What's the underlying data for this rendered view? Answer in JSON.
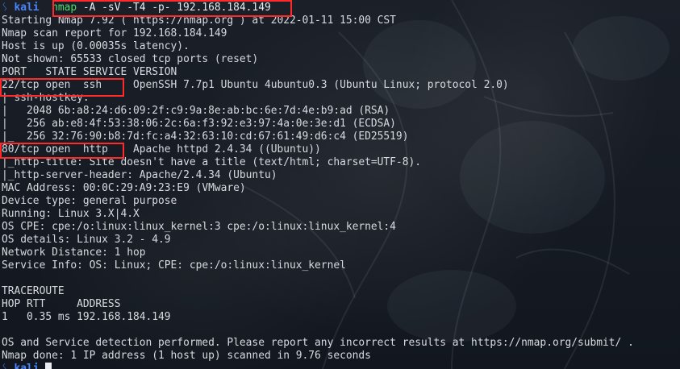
{
  "terminal": {
    "prompt": {
      "icon": "kali-dragon-icon",
      "user": "kali",
      "command_name": "nmap",
      "command_args": " -A -sV -T4 -p- 192.168.184.149"
    },
    "output": [
      "Starting Nmap 7.92 ( https://nmap.org ) at 2022-01-11 15:00 CST",
      "Nmap scan report for 192.168.184.149",
      "Host is up (0.00035s latency).",
      "Not shown: 65533 closed tcp ports (reset)",
      "PORT   STATE SERVICE VERSION",
      "22/tcp open  ssh     OpenSSH 7.7p1 Ubuntu 4ubuntu0.3 (Ubuntu Linux; protocol 2.0)",
      "| ssh-hostkey:",
      "|   2048 6b:a8:24:d6:09:2f:c9:9a:8e:ab:bc:6e:7d:4e:b9:ad (RSA)",
      "|   256 ab:e8:4f:53:38:06:2c:6a:f3:92:e3:97:4a:0e:3e:d1 (ECDSA)",
      "|_  256 32:76:90:b8:7d:fc:a4:32:63:10:cd:67:61:49:d6:c4 (ED25519)",
      "80/tcp open  http    Apache httpd 2.4.34 ((Ubuntu))",
      "|_http-title: Site doesn't have a title (text/html; charset=UTF-8).",
      "|_http-server-header: Apache/2.4.34 (Ubuntu)",
      "MAC Address: 00:0C:29:A9:23:E9 (VMware)",
      "Device type: general purpose",
      "Running: Linux 3.X|4.X",
      "OS CPE: cpe:/o:linux:linux_kernel:3 cpe:/o:linux:linux_kernel:4",
      "OS details: Linux 3.2 - 4.9",
      "Network Distance: 1 hop",
      "Service Info: OS: Linux; CPE: cpe:/o:linux:linux_kernel",
      "",
      "TRACEROUTE",
      "HOP RTT     ADDRESS",
      "1   0.35 ms 192.168.184.149",
      "",
      "OS and Service detection performed. Please report any incorrect results at https://nmap.org/submit/ .",
      "Nmap done: 1 IP address (1 host up) scanned in 9.76 seconds"
    ],
    "final_prompt": {
      "user": "kali"
    }
  },
  "colors": {
    "prompt": "#4a86ff",
    "command": "#4fdc6c",
    "highlight_box": "#ff2a2a",
    "text": "#d7dbe0"
  }
}
